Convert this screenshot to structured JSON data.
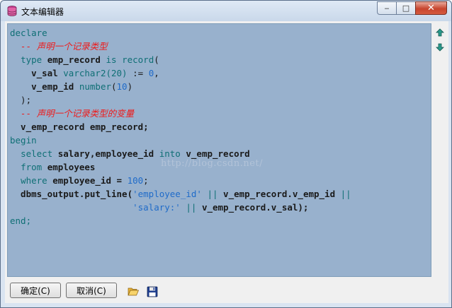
{
  "window": {
    "title": "文本编辑器",
    "min_symbol": "‒",
    "max_symbol": "□",
    "close_symbol": "✕"
  },
  "editor": {
    "watermark": "http://blog.csdn.net/",
    "lines": [
      [
        {
          "t": "declare",
          "c": "kw"
        }
      ],
      [
        {
          "t": "  -- 声明一个记录类型",
          "c": "cm"
        }
      ],
      [
        {
          "t": "  ",
          "c": "op"
        },
        {
          "t": "type",
          "c": "kw"
        },
        {
          "t": " emp_record ",
          "c": "id"
        },
        {
          "t": "is",
          "c": "kw"
        },
        {
          "t": " ",
          "c": "op"
        },
        {
          "t": "record",
          "c": "kw"
        },
        {
          "t": "(",
          "c": "op"
        }
      ],
      [
        {
          "t": "    v_sal ",
          "c": "id"
        },
        {
          "t": "varchar2(20)",
          "c": "kw"
        },
        {
          "t": " := ",
          "c": "op"
        },
        {
          "t": "0",
          "c": "num"
        },
        {
          "t": ",",
          "c": "op"
        }
      ],
      [
        {
          "t": "    v_emp_id ",
          "c": "id"
        },
        {
          "t": "number",
          "c": "kw"
        },
        {
          "t": "(",
          "c": "op"
        },
        {
          "t": "10",
          "c": "num"
        },
        {
          "t": ")",
          "c": "op"
        }
      ],
      [
        {
          "t": "  );",
          "c": "op"
        }
      ],
      [
        {
          "t": "  -- 声明一个记录类型的变量",
          "c": "cm"
        }
      ],
      [
        {
          "t": "  v_emp_record emp_record;",
          "c": "id"
        }
      ],
      [
        {
          "t": "begin",
          "c": "kw"
        }
      ],
      [
        {
          "t": "  ",
          "c": "op"
        },
        {
          "t": "select",
          "c": "kw"
        },
        {
          "t": " salary,employee_id ",
          "c": "id"
        },
        {
          "t": "into",
          "c": "kw"
        },
        {
          "t": " v_emp_record",
          "c": "id"
        }
      ],
      [
        {
          "t": "  ",
          "c": "op"
        },
        {
          "t": "from",
          "c": "kw"
        },
        {
          "t": " employees",
          "c": "id"
        }
      ],
      [
        {
          "t": "  ",
          "c": "op"
        },
        {
          "t": "where",
          "c": "kw"
        },
        {
          "t": " employee_id = ",
          "c": "id"
        },
        {
          "t": "100",
          "c": "num"
        },
        {
          "t": ";",
          "c": "op"
        }
      ],
      [
        {
          "t": "  dbms_output.put_line(",
          "c": "id"
        },
        {
          "t": "'employee_id'",
          "c": "str"
        },
        {
          "t": " ",
          "c": "op"
        },
        {
          "t": "||",
          "c": "kw"
        },
        {
          "t": " v_emp_record.v_emp_id ",
          "c": "id"
        },
        {
          "t": "||",
          "c": "kw"
        }
      ],
      [
        {
          "t": "                       ",
          "c": "op"
        },
        {
          "t": "'salary:'",
          "c": "str"
        },
        {
          "t": " ",
          "c": "op"
        },
        {
          "t": "||",
          "c": "kw"
        },
        {
          "t": " v_emp_record.v_sal);",
          "c": "id"
        }
      ],
      [
        {
          "t": "end;",
          "c": "kw"
        }
      ]
    ]
  },
  "side_tools": {
    "up_icon": "arrow-up-icon",
    "down_icon": "arrow-down-icon"
  },
  "bottom": {
    "ok_label": "确定(C)",
    "cancel_label": "取消(C)",
    "open_icon": "folder-open-icon",
    "save_icon": "floppy-disk-icon"
  },
  "colors": {
    "editor_bg": "#98b1cd",
    "keyword": "#0f6f75",
    "comment": "#ee1a1a",
    "number": "#1f6bc9",
    "identifier": "#1a1a1a"
  }
}
